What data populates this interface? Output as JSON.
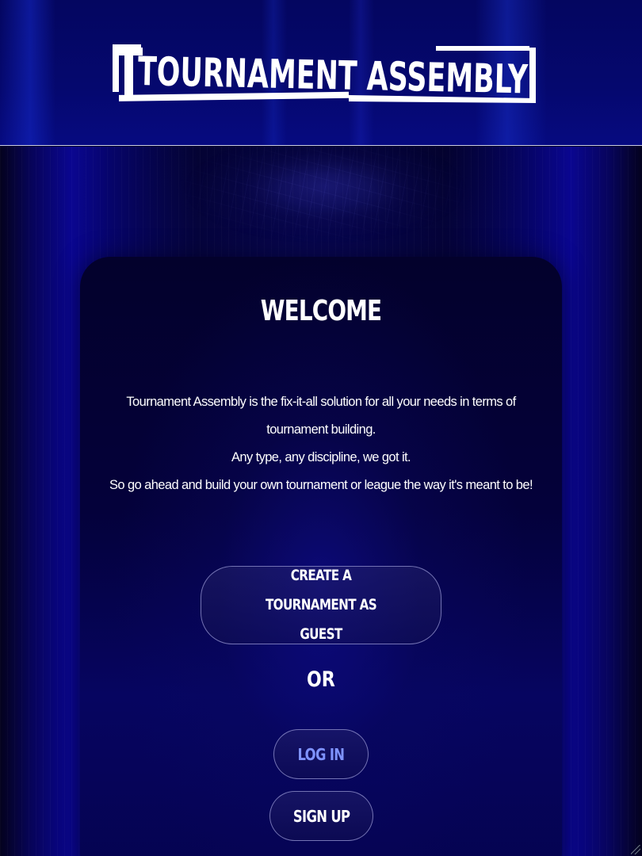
{
  "header": {
    "logo_text": "TOURNAMENT ASSEMBLY"
  },
  "welcome": {
    "title": "WELCOME",
    "intro_lines": [
      "Tournament Assembly is the fix-it-all solution for all your needs in terms of",
      "tournament building.",
      "Any type, any discipline, we got it.",
      "So go ahead and build your own tournament or league the way it's meant to be!"
    ]
  },
  "actions": {
    "guest_button": "CREATE A TOURNAMENT AS GUEST",
    "or_label": "OR",
    "login_button": "LOG IN",
    "signup_button": "SIGN UP"
  },
  "colors": {
    "header_bg": "#05086e",
    "card_bg": "#03012c",
    "login_text": "#7f93ff",
    "text": "#ffffff"
  }
}
